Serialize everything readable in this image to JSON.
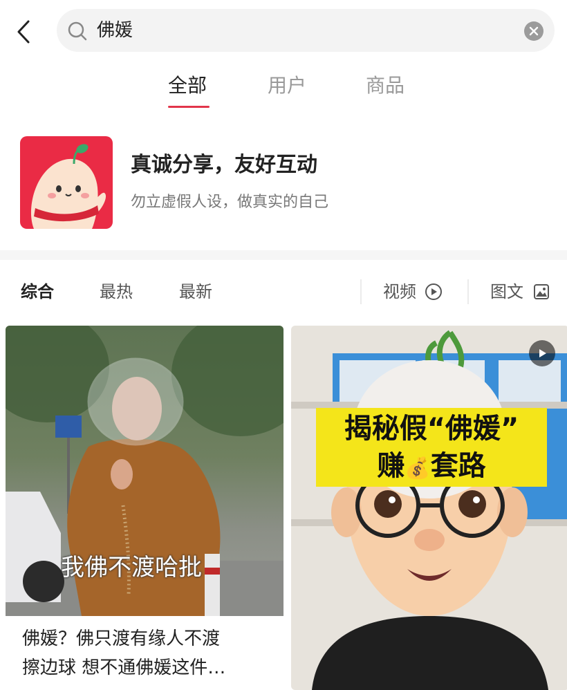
{
  "search": {
    "query": "佛媛"
  },
  "tabs": [
    {
      "label": "全部",
      "active": true
    },
    {
      "label": "用户",
      "active": false
    },
    {
      "label": "商品",
      "active": false
    }
  ],
  "banner": {
    "title": "真诚分享，友好互动",
    "subtitle": "勿立虚假人设，做真实的自己"
  },
  "filters": {
    "sort": [
      "综合",
      "最热",
      "最新"
    ],
    "video_label": "视频",
    "image_text_label": "图文"
  },
  "cards": [
    {
      "overlay_text": "我佛不渡哈批",
      "caption_line1": "佛媛？佛只渡有缘人不渡",
      "caption_line2": "擦边球 想不通佛媛这件…"
    },
    {
      "banner_line1": "揭秘假“佛媛”",
      "banner_line2_a": "赚",
      "banner_line2_b": "套路",
      "money_emoji": "💰",
      "is_video": true
    }
  ],
  "colors": {
    "accent": "#e2354a",
    "brand_red": "#ea2b45",
    "banner_yellow": "#f4e51a"
  }
}
